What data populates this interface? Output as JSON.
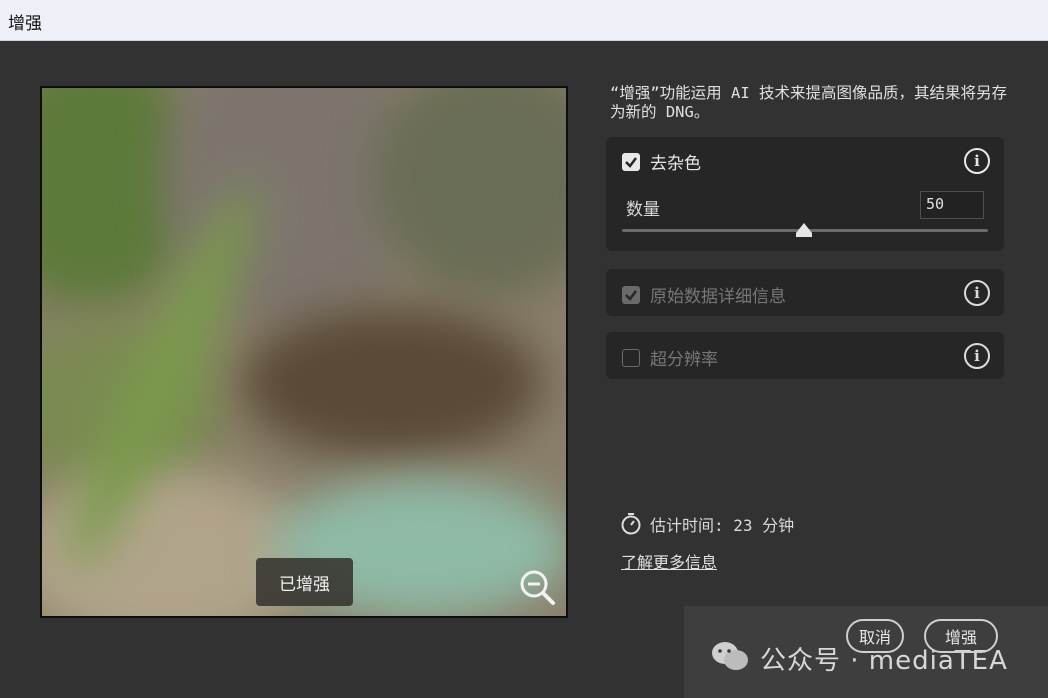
{
  "window": {
    "title": "增强"
  },
  "preview": {
    "badge": "已增强",
    "zoom_icon": "zoom-out-icon"
  },
  "description": "“增强”功能运用 AI 技术来提高图像品质，其结果将另存为新的 DNG。",
  "denoise": {
    "label": "去杂色",
    "checked": true,
    "amount_label": "数量",
    "amount_value": "50",
    "amount": 50,
    "amount_range": [
      0,
      100
    ]
  },
  "raw_details": {
    "label": "原始数据详细信息",
    "checked": true,
    "enabled": false
  },
  "super_resolution": {
    "label": "超分辨率",
    "checked": false,
    "enabled": false
  },
  "estimate": {
    "text": "估计时间: 23 分钟"
  },
  "learn_more": "了解更多信息",
  "buttons": {
    "cancel": "取消",
    "enhance": "增强"
  },
  "watermark": {
    "text": "公众号 · mediaTEA"
  },
  "colors": {
    "background": "#323232",
    "panel": "#262626",
    "titlebar": "#eef0f8"
  }
}
